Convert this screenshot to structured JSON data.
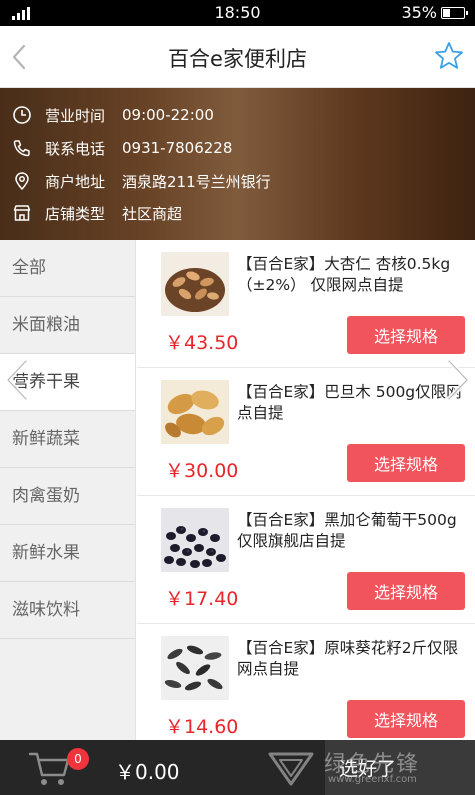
{
  "status_bar": {
    "time": "18:50",
    "battery_percent": "35%",
    "battery_level": 0.35
  },
  "header": {
    "title": "百合e家便利店",
    "back_icon": "chevron-left-icon",
    "favorite_icon": "star-outline-icon"
  },
  "store_info": {
    "rows": [
      {
        "icon": "clock-icon",
        "label": "营业时间",
        "value": "09:00-22:00"
      },
      {
        "icon": "phone-icon",
        "label": "联系电话",
        "value": "0931-7806228"
      },
      {
        "icon": "location-pin-icon",
        "label": "商户地址",
        "value": "酒泉路211号兰州银行"
      },
      {
        "icon": "store-icon",
        "label": "店铺类型",
        "value": "社区商超"
      }
    ]
  },
  "categories": [
    {
      "label": "全部",
      "active": false
    },
    {
      "label": "米面粮油",
      "active": false
    },
    {
      "label": "营养干果",
      "active": true
    },
    {
      "label": "新鲜蔬菜",
      "active": false
    },
    {
      "label": "肉禽蛋奶",
      "active": false
    },
    {
      "label": "新鲜水果",
      "active": false
    },
    {
      "label": "滋味饮料",
      "active": false
    }
  ],
  "products": [
    {
      "name": "【百合E家】大杏仁 杏核0.5kg（±2%） 仅限网点自提",
      "price": "￥43.50",
      "button": "选择规格"
    },
    {
      "name": "【百合E家】巴旦木 500g仅限网点自提",
      "price": "￥30.00",
      "button": "选择规格"
    },
    {
      "name": "【百合E家】黑加仑葡萄干500g 仅限旗舰店自提",
      "price": "￥17.40",
      "button": "选择规格"
    },
    {
      "name": "【百合E家】原味葵花籽2斤仅限网点自提",
      "price": "￥14.60",
      "button": "选择规格"
    }
  ],
  "cart": {
    "badge_count": "0",
    "total": "￥0.00",
    "done_label": "选好了"
  },
  "watermark": {
    "text": "绿色先锋",
    "url": "www.greenxf.com"
  },
  "colors": {
    "accent_red": "#f2545b",
    "price_red": "#e8262a",
    "star_blue": "#3aa0e6",
    "cart_bar": "#262626"
  }
}
